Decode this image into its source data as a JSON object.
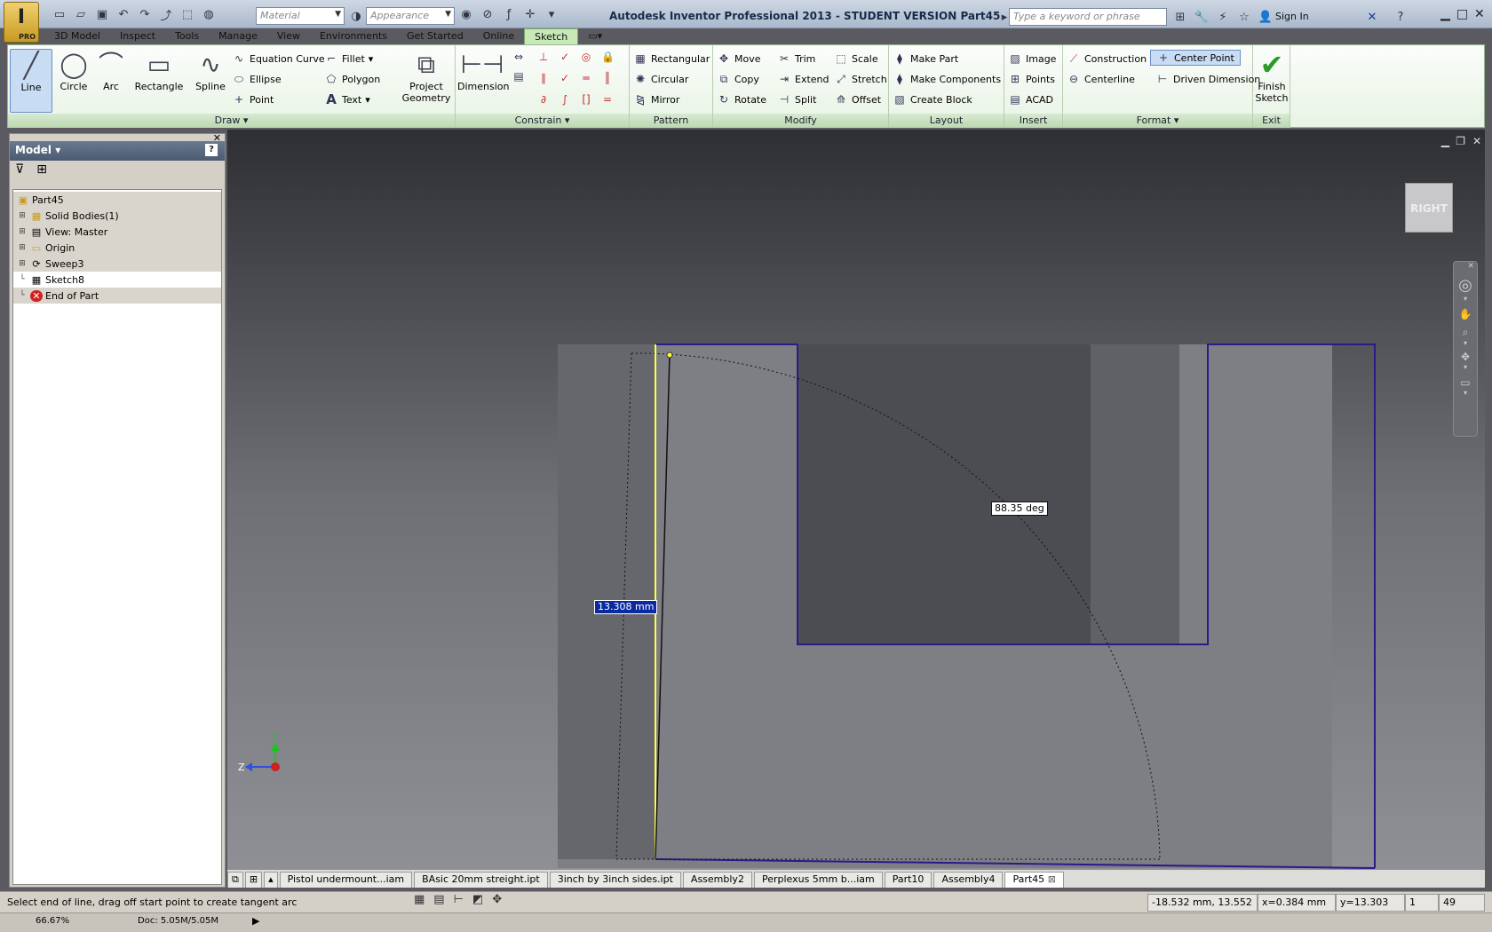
{
  "window": {
    "title": "Autodesk Inventor Professional 2013 - STUDENT VERSION   Part45",
    "app_badge": "PRO",
    "search_placeholder": "Type a keyword or phrase",
    "sign_in": "Sign In"
  },
  "qat": {
    "material_placeholder": "Material",
    "appearance_placeholder": "Appearance"
  },
  "tabs": [
    "3D Model",
    "Inspect",
    "Tools",
    "Manage",
    "View",
    "Environments",
    "Get Started",
    "Online",
    "Sketch"
  ],
  "active_tab": "Sketch",
  "ribbon": {
    "draw": {
      "label": "Draw",
      "line": "Line",
      "circle": "Circle",
      "arc": "Arc",
      "rectangle": "Rectangle",
      "spline": "Spline",
      "equation_curve": "Equation Curve",
      "ellipse": "Ellipse",
      "point": "Point",
      "fillet": "Fillet",
      "polygon": "Polygon",
      "text": "Text",
      "project_geometry_1": "Project",
      "project_geometry_2": "Geometry"
    },
    "constrain": {
      "label": "Constrain",
      "dimension": "Dimension"
    },
    "pattern": {
      "label": "Pattern",
      "rectangular": "Rectangular",
      "circular": "Circular",
      "mirror": "Mirror"
    },
    "modify": {
      "label": "Modify",
      "move": "Move",
      "copy": "Copy",
      "rotate": "Rotate",
      "trim": "Trim",
      "extend": "Extend",
      "split": "Split",
      "scale": "Scale",
      "stretch": "Stretch",
      "offset": "Offset"
    },
    "layout": {
      "label": "Layout",
      "make_part": "Make Part",
      "make_components": "Make Components",
      "create_block": "Create Block"
    },
    "insert": {
      "label": "Insert",
      "image": "Image",
      "points": "Points",
      "acad": "ACAD"
    },
    "format": {
      "label": "Format",
      "construction": "Construction",
      "centerline": "Centerline",
      "center_point": "Center Point",
      "driven_dimension": "Driven Dimension"
    },
    "exit": {
      "label": "Exit",
      "finish_1": "Finish",
      "finish_2": "Sketch"
    }
  },
  "browser": {
    "title": "Model",
    "tree": [
      {
        "label": "Part45",
        "icon": "part-icon"
      },
      {
        "label": "Solid Bodies(1)",
        "icon": "solid-bodies-icon"
      },
      {
        "label": "View: Master",
        "icon": "view-icon"
      },
      {
        "label": "Origin",
        "icon": "folder-icon"
      },
      {
        "label": "Sweep3",
        "icon": "sweep-icon"
      },
      {
        "label": "Sketch8",
        "icon": "sketch-icon"
      },
      {
        "label": "End of Part",
        "icon": "end-of-part-icon"
      }
    ]
  },
  "viewport": {
    "viewcube_label": "RIGHT",
    "length_input": "13.308 mm",
    "angle_input": "88.35 deg",
    "axis_z": "Z",
    "axis_y": "Y"
  },
  "doc_tabs": [
    "Pistol undermount...iam",
    "BAsic 20mm streight.ipt",
    "3inch by 3inch sides.ipt",
    "Assembly2",
    "Perplexus 5mm b...iam",
    "Part10",
    "Assembly4",
    "Part45"
  ],
  "active_doc": "Part45",
  "status": {
    "message": "Select end of line, drag off start point to create tangent arc",
    "coords": "-18.532 mm, 13.552 mm",
    "x": "x=0.384 mm",
    "y": "y=13.303 mm",
    "count1": "1",
    "count2": "49",
    "zoom": "66.67%",
    "doc_memory": "Doc: 5.05M/5.05M"
  },
  "colors": {
    "ribbon_green": "#c8e8b8",
    "sketch_outline": "#2a1a8a",
    "active_line": "#ffff40"
  }
}
